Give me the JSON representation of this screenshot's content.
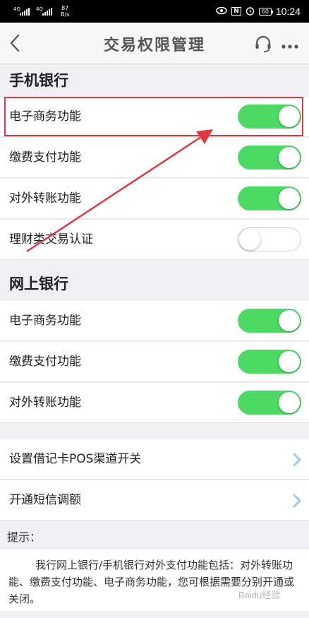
{
  "status_bar": {
    "signal_1_tag": "4G",
    "signal_2_tag": "4G",
    "net_speed_value": "87",
    "net_speed_unit": "B/s",
    "nfc_label": "N",
    "battery_level": "60",
    "time": "10:24",
    "icons": [
      "eye-icon",
      "nfc-icon",
      "alarm-icon",
      "battery-icon"
    ]
  },
  "nav": {
    "title": "交易权限管理",
    "icons": [
      "back-icon",
      "headset-icon",
      "more-icon"
    ]
  },
  "mobile_banking": {
    "title": "手机银行",
    "items": [
      {
        "label": "电子商务功能",
        "enabled": true
      },
      {
        "label": "缴费支付功能",
        "enabled": true
      },
      {
        "label": "对外转账功能",
        "enabled": true
      },
      {
        "label": "理财类交易认证",
        "enabled": false
      }
    ]
  },
  "online_banking": {
    "title": "网上银行",
    "items": [
      {
        "label": "电子商务功能",
        "enabled": true
      },
      {
        "label": "缴费支付功能",
        "enabled": true
      },
      {
        "label": "对外转账功能",
        "enabled": true
      }
    ]
  },
  "links": [
    {
      "label": "设置借记卡POS渠道开关"
    },
    {
      "label": "开通短信调额"
    }
  ],
  "tip": {
    "title": "提示：",
    "body": "我行网上银行/手机银行对外支付功能包括：对外转账功能、缴费支付功能、电子商务功能，您可根据需要分别开通或关闭。"
  },
  "watermark": "Baidu经验",
  "colors": {
    "toggle_on": "#4cd964",
    "annotation": "#e0383e",
    "background": "#efeff4"
  }
}
